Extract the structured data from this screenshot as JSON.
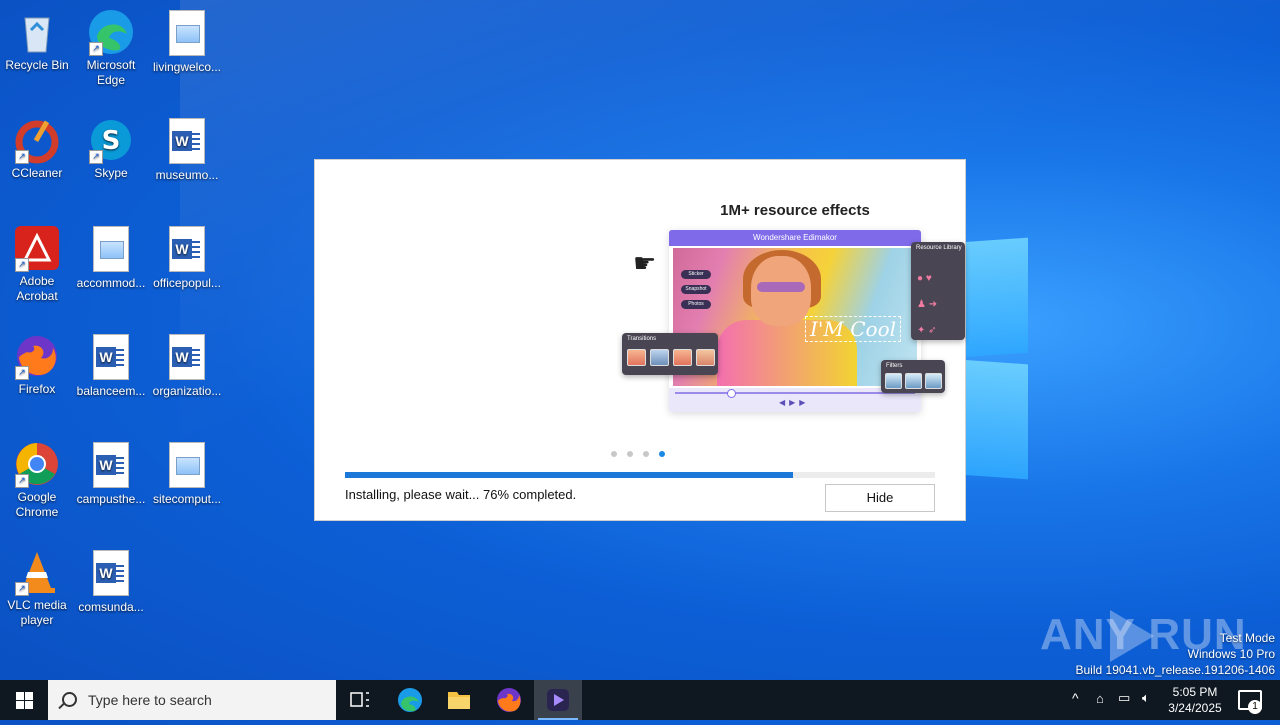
{
  "desktop": {
    "icons": [
      {
        "label": "Recycle Bin"
      },
      {
        "label": "Microsoft Edge"
      },
      {
        "label": "livingwelco..."
      },
      {
        "label": "CCleaner"
      },
      {
        "label": "Skype"
      },
      {
        "label": "museumo..."
      },
      {
        "label": "Adobe Acrobat"
      },
      {
        "label": "accommod..."
      },
      {
        "label": "officepopul..."
      },
      {
        "label": "Firefox"
      },
      {
        "label": "balanceem..."
      },
      {
        "label": "organizatio..."
      },
      {
        "label": "Google Chrome"
      },
      {
        "label": "campusthe..."
      },
      {
        "label": "sitecomput..."
      },
      {
        "label": "VLC media player"
      },
      {
        "label": "comsunda..."
      }
    ]
  },
  "installer": {
    "slide_title": "1M+ resource effects",
    "slide_app_name": "Wondershare Edimakor",
    "slide_sticker_text": "I'M Cool",
    "slide_panel_transitions": "Transitions",
    "slide_panel_filters": "Filters",
    "slide_panel_library": "Resource Library",
    "slide_chips": [
      "Sticker",
      "Snapshot",
      "Photos"
    ],
    "slides_total": 4,
    "slide_active_index": 3,
    "progress_percent": 76,
    "status_text": "Installing, please wait... 76% completed.",
    "hide_label": "Hide"
  },
  "watermark": {
    "text": "ANY RUN"
  },
  "system_info": {
    "line1": "Test Mode",
    "line2": "Windows 10 Pro",
    "line3": "Build 19041.vb_release.191206-1406"
  },
  "taskbar": {
    "search_placeholder": "Type here to search",
    "pinned": [
      "task-view",
      "edge",
      "file-explorer",
      "firefox",
      "installer-app"
    ],
    "clock_time": "5:05 PM",
    "clock_date": "3/24/2025",
    "notification_count": "1"
  },
  "colors": {
    "accent": "#1b78d8",
    "taskbar_bg": "#0f1720",
    "desktop_blue": "#0d5fd6"
  }
}
